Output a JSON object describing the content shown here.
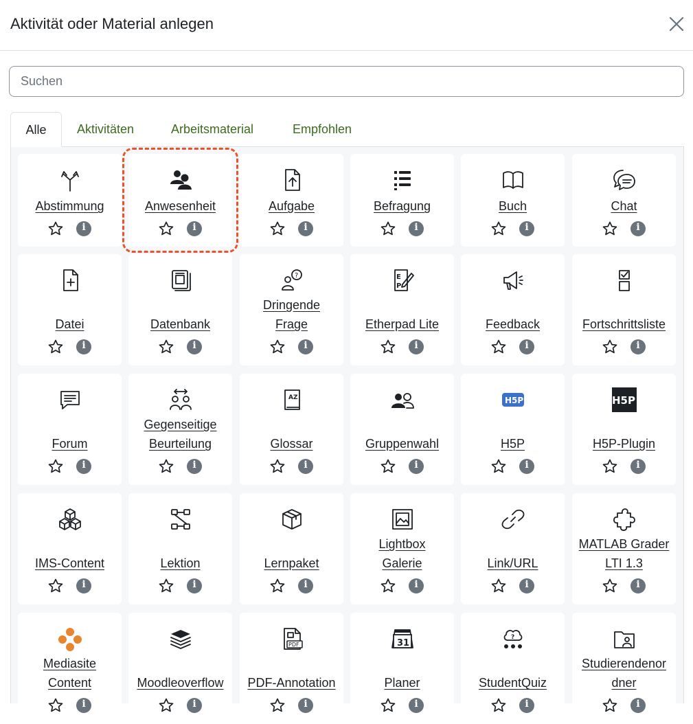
{
  "dialog": {
    "title": "Aktivität oder Material anlegen",
    "search_placeholder": "Suchen"
  },
  "tabs": [
    {
      "label": "Alle",
      "active": true
    },
    {
      "label": "Aktivitäten",
      "active": false
    },
    {
      "label": "Arbeitsmaterial",
      "active": false
    },
    {
      "label": "Empfohlen",
      "active": false
    }
  ],
  "colors": {
    "link": "#3d6b1f",
    "focus_outline": "#e8542e",
    "info": "#6a737b",
    "h5p_blue": "#3b71c9",
    "mediasite_orange": "#e8852f"
  },
  "modules": [
    {
      "label": "Abstimmung",
      "icon": "split-arrows-icon"
    },
    {
      "label": "Anwesenheit",
      "icon": "attendance-icon"
    },
    {
      "label": "Aufgabe",
      "icon": "file-upload-icon"
    },
    {
      "label": "Befragung",
      "icon": "list-icon"
    },
    {
      "label": "Buch",
      "icon": "book-icon"
    },
    {
      "label": "Chat",
      "icon": "chat-bubbles-icon"
    },
    {
      "label": "Datei",
      "icon": "file-plus-icon"
    },
    {
      "label": "Datenbank",
      "icon": "database-icon"
    },
    {
      "label": "Dringende Frage",
      "icon": "question-person-icon"
    },
    {
      "label": "Etherpad Lite",
      "icon": "etherpad-icon"
    },
    {
      "label": "Feedback",
      "icon": "megaphone-icon"
    },
    {
      "label": "Fortschrittsliste",
      "icon": "checklist-icon"
    },
    {
      "label": "Forum",
      "icon": "forum-icon"
    },
    {
      "label": "Gegenseitige Beurteilung",
      "icon": "peer-review-icon"
    },
    {
      "label": "Glossar",
      "icon": "glossary-icon"
    },
    {
      "label": "Gruppenwahl",
      "icon": "group-icon"
    },
    {
      "label": "H5P",
      "icon": "h5p-icon"
    },
    {
      "label": "H5P-Plugin",
      "icon": "h5p-plugin-icon"
    },
    {
      "label": "IMS-Content",
      "icon": "cubes-icon"
    },
    {
      "label": "Lektion",
      "icon": "lesson-icon"
    },
    {
      "label": "Lernpaket",
      "icon": "package-icon"
    },
    {
      "label": "Lightbox Galerie",
      "icon": "gallery-icon"
    },
    {
      "label": "Link/URL",
      "icon": "link-icon"
    },
    {
      "label": "MATLAB Grader LTI 1.3",
      "icon": "puzzle-icon"
    },
    {
      "label": "Mediasite Content",
      "icon": "mediasite-icon"
    },
    {
      "label": "Moodleoverflow",
      "icon": "stack-icon"
    },
    {
      "label": "PDF-Annotation",
      "icon": "pdf-icon"
    },
    {
      "label": "Planer",
      "icon": "calendar-icon"
    },
    {
      "label": "StudentQuiz",
      "icon": "quiz-icon"
    },
    {
      "label": "Studierendenordner",
      "icon": "folder-icon"
    }
  ],
  "row_labels_split": {
    "Dringende Frage": [
      "Dringende",
      "Frage"
    ],
    "Gegenseitige Beurteilung": [
      "Gegenseitige",
      "Beurteilung"
    ],
    "Lightbox Galerie": [
      "Lightbox",
      "Galerie"
    ],
    "MATLAB Grader LTI 1.3": [
      "MATLAB Grader",
      "LTI 1.3"
    ],
    "Mediasite Content": [
      "Mediasite",
      "Content"
    ],
    "Studierendenordner": [
      "Studierendenor",
      "dner"
    ]
  }
}
